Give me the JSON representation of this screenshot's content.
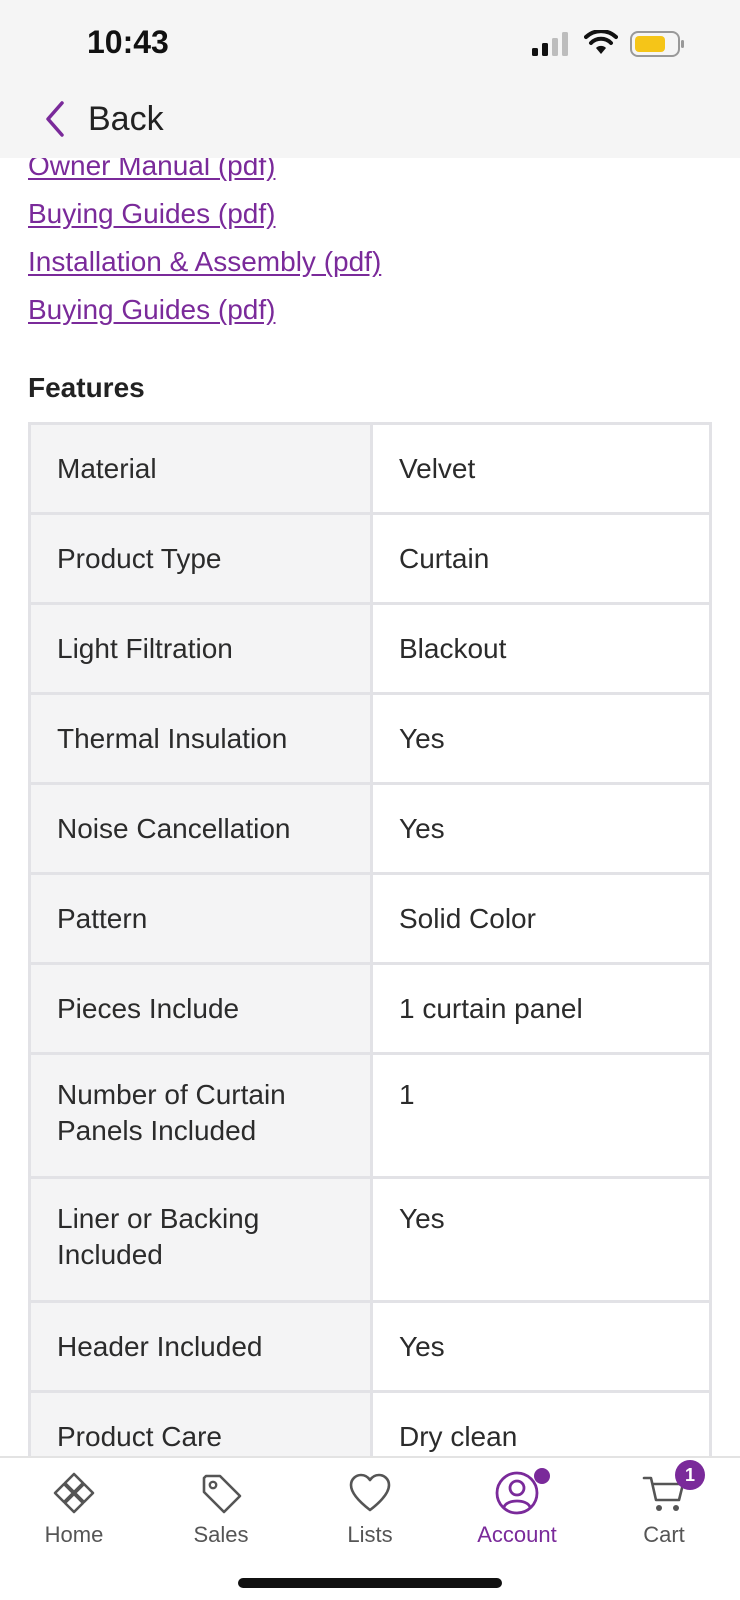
{
  "status": {
    "time": "10:43"
  },
  "nav": {
    "back_label": "Back"
  },
  "documents": [
    {
      "label": "Owner Manual (pdf)"
    },
    {
      "label": "Buying Guides (pdf)"
    },
    {
      "label": "Installation & Assembly (pdf)"
    },
    {
      "label": "Buying Guides (pdf)"
    }
  ],
  "features": {
    "heading": "Features",
    "rows": [
      {
        "label": "Material",
        "value": "Velvet"
      },
      {
        "label": "Product Type",
        "value": "Curtain"
      },
      {
        "label": "Light Filtration",
        "value": "Blackout"
      },
      {
        "label": "Thermal Insulation",
        "value": "Yes"
      },
      {
        "label": "Noise Cancellation",
        "value": "Yes"
      },
      {
        "label": "Pattern",
        "value": "Solid Color"
      },
      {
        "label": "Pieces Include",
        "value": "1 curtain panel"
      },
      {
        "label": "Number of Curtain Panels Included",
        "value": "1"
      },
      {
        "label": "Liner or Backing Included",
        "value": "Yes"
      },
      {
        "label": "Header Included",
        "value": "Yes"
      },
      {
        "label": "Product Care",
        "value": "Dry clean"
      }
    ]
  },
  "tabbar": {
    "home": {
      "label": "Home",
      "icon": "home-icon"
    },
    "sales": {
      "label": "Sales",
      "icon": "tag-icon"
    },
    "lists": {
      "label": "Lists",
      "icon": "heart-icon"
    },
    "account": {
      "label": "Account",
      "icon": "account-icon",
      "active": true
    },
    "cart": {
      "label": "Cart",
      "icon": "cart-icon",
      "badge": "1"
    }
  },
  "colors": {
    "accent": "#7a2a9a",
    "battery": "#f5c518"
  }
}
